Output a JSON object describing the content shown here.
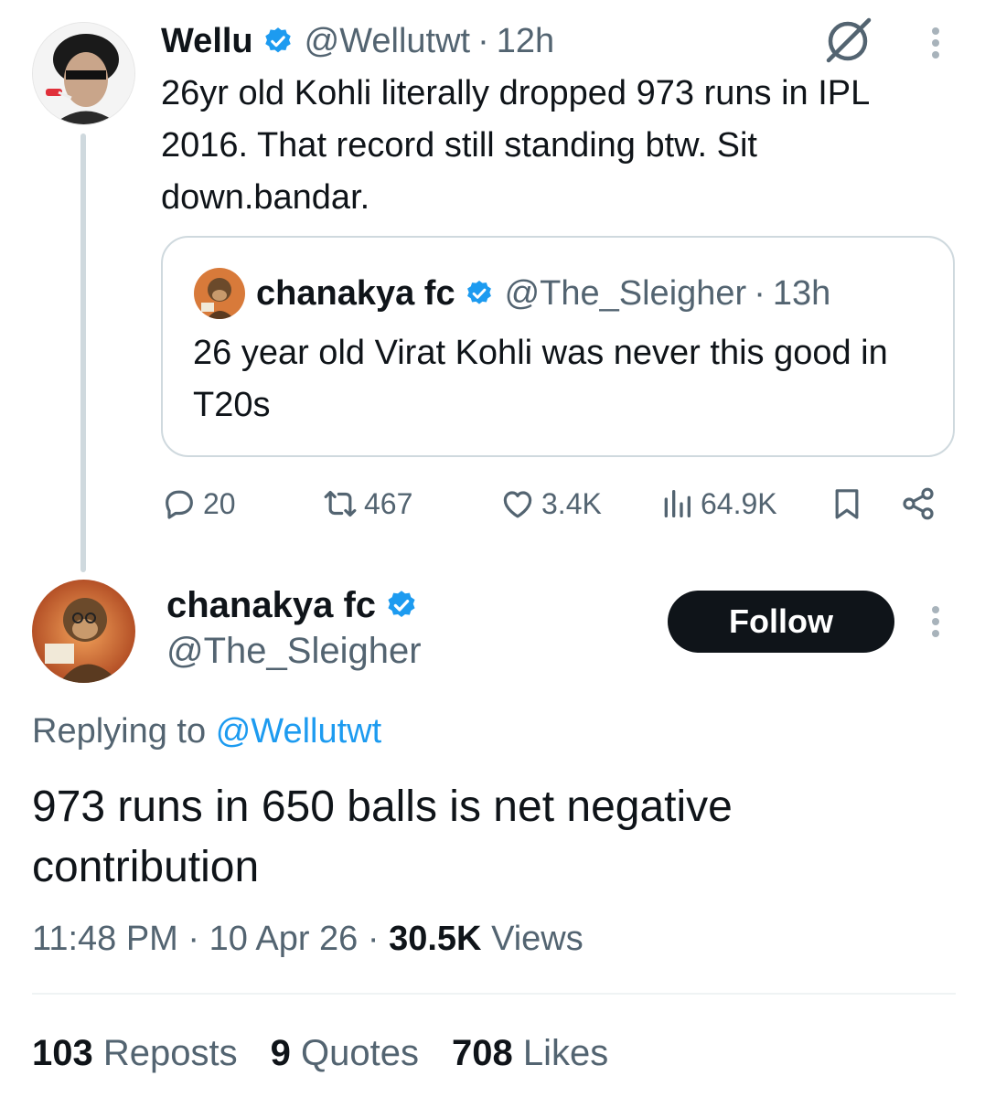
{
  "parent_tweet": {
    "name": "Wellu",
    "handle": "@Wellutwt",
    "separator": "·",
    "time": "12h",
    "text": "26yr old Kohli literally dropped 973 runs in IPL 2016. That record still standing btw. Sit down.bandar.",
    "quoted_tweet": {
      "name": "chanakya fc",
      "handle": "@The_Sleigher",
      "separator": "·",
      "time": "13h",
      "text": "26 year old Virat Kohli was never this good in T20s"
    },
    "actions": {
      "replies": "20",
      "reposts": "467",
      "likes": "3.4K",
      "views": "64.9K"
    }
  },
  "main_tweet": {
    "name": "chanakya fc",
    "handle": "@The_Sleigher",
    "follow_label": "Follow",
    "replying_prefix": "Replying to",
    "replying_to": "@Wellutwt",
    "text": "973 runs in 650 balls is net negative contribution",
    "time": "11:48 PM",
    "date": "10 Apr 26",
    "views_count": "30.5K",
    "views_label": "Views",
    "stats": {
      "reposts_count": "103",
      "reposts_label": "Reposts",
      "quotes_count": "9",
      "quotes_label": "Quotes",
      "likes_count": "708",
      "likes_label": "Likes"
    }
  },
  "colors": {
    "text_primary": "#0f1419",
    "text_secondary": "#536471",
    "accent_blue": "#1d9bf0",
    "border": "#cfd9de",
    "button_dark": "#0f1419"
  },
  "icons": [
    "verified-badge-icon",
    "grok-icon",
    "more-icon",
    "reply-icon",
    "repost-icon",
    "like-icon",
    "views-icon",
    "bookmark-icon",
    "share-icon"
  ]
}
